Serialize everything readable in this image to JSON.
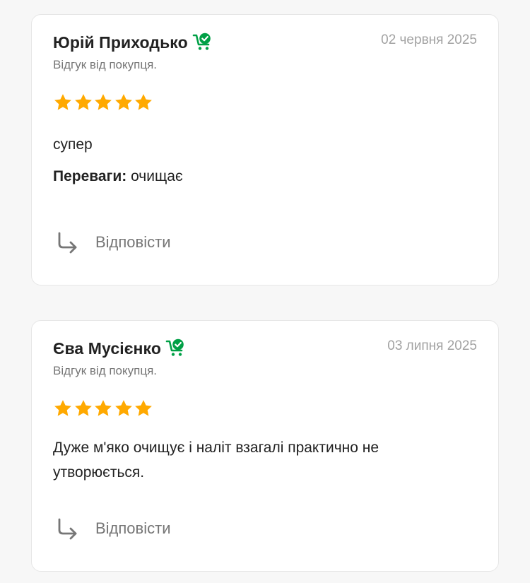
{
  "colors": {
    "star": "#ffa900",
    "buyer_badge": "#00a046",
    "date": "#a2a2a2",
    "label": "#767676",
    "card_border": "#e6e6e6"
  },
  "reviews": [
    {
      "author": "Юрій Приходько",
      "buyer_icon": "shopping-cart-check-icon",
      "date": "02 червня 2025",
      "label": "Відгук від покупця.",
      "rating": 5,
      "text": "супер",
      "pros_label": "Переваги:",
      "pros": "очищає",
      "reply_label": "Відповісти",
      "reply_icon": "reply-arrow-icon"
    },
    {
      "author": "Єва Мусієнко",
      "buyer_icon": "shopping-cart-check-icon",
      "date": "03 липня 2025",
      "label": "Відгук від покупця.",
      "rating": 5,
      "text": "Дуже м'яко очищує і наліт взагалі практично не утворюється.",
      "reply_label": "Відповісти",
      "reply_icon": "reply-arrow-icon"
    }
  ]
}
